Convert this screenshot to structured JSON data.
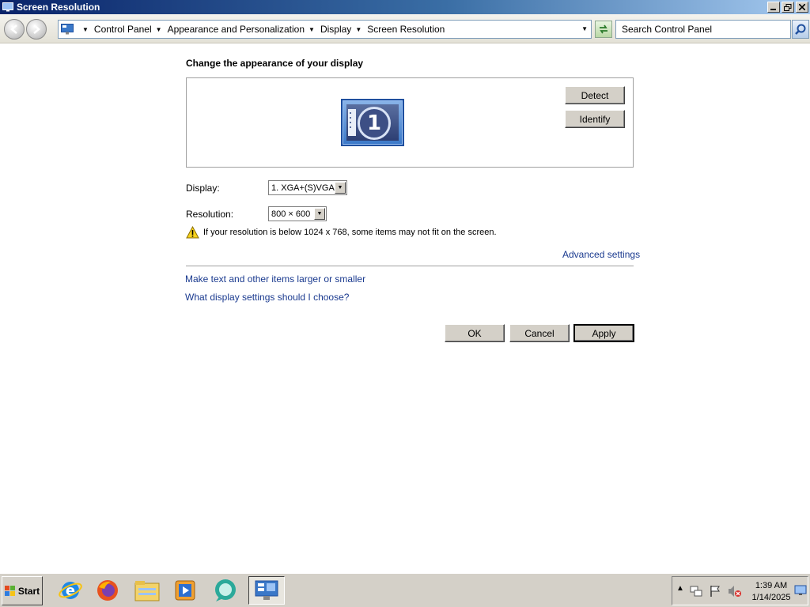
{
  "window": {
    "title": "Screen Resolution"
  },
  "address_bar": {
    "breadcrumbs": [
      "Control Panel",
      "Appearance and Personalization",
      "Display",
      "Screen Resolution"
    ],
    "search_placeholder": "Search Control Panel"
  },
  "content": {
    "heading": "Change the appearance of your display",
    "monitor_number": "1",
    "detect_label": "Detect",
    "identify_label": "Identify",
    "display_label": "Display:",
    "display_value": "1. XGA+(S)VGA",
    "resolution_label": "Resolution:",
    "resolution_value": "800 × 600",
    "warning_text": "If your resolution is below 1024 x 768, some items may not fit on the screen.",
    "advanced_link": "Advanced settings",
    "link_text_size": "Make text and other items larger or smaller",
    "link_display_help": "What display settings should I choose?",
    "ok_label": "OK",
    "cancel_label": "Cancel",
    "apply_label": "Apply"
  },
  "taskbar": {
    "start_label": "Start",
    "pinned": [
      "internet-explorer-icon",
      "firefox-icon",
      "file-explorer-icon",
      "media-player-icon",
      "chat-bubble-icon",
      "display-settings-icon"
    ],
    "clock_time": "1:39 AM",
    "clock_date": "1/14/2025"
  },
  "colors": {
    "link": "#1a3a8f",
    "titlebar": "#0a246a",
    "chrome": "#d4d0c8"
  }
}
